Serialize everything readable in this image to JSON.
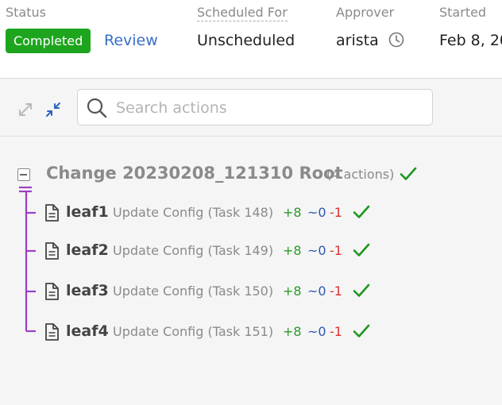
{
  "header": {
    "status": {
      "label": "Status",
      "badge": "Completed",
      "link": "Review"
    },
    "scheduled": {
      "label": "Scheduled For",
      "value": "Unscheduled"
    },
    "approver": {
      "label": "Approver",
      "value": "arista"
    },
    "started": {
      "label": "Started",
      "value": "Feb 8, 20"
    }
  },
  "toolbar": {
    "expand_icon": "expand-icon",
    "collapse_icon": "collapse-icon",
    "search_placeholder": "Search actions"
  },
  "tree": {
    "root": {
      "title": "Change 20230208_121310 Root",
      "count": "(4 actions)"
    },
    "leaves": [
      {
        "name": "leaf1",
        "desc": "Update Config (Task 148)",
        "added": "+8",
        "modified": "~0",
        "removed": "-1"
      },
      {
        "name": "leaf2",
        "desc": "Update Config (Task 149)",
        "added": "+8",
        "modified": "~0",
        "removed": "-1"
      },
      {
        "name": "leaf3",
        "desc": "Update Config (Task 150)",
        "added": "+8",
        "modified": "~0",
        "removed": "-1"
      },
      {
        "name": "leaf4",
        "desc": "Update Config (Task 151)",
        "added": "+8",
        "modified": "~0",
        "removed": "-1"
      }
    ]
  },
  "colors": {
    "success": "#1ea51e",
    "link": "#3a6fc4",
    "tree_line": "#9b3fc4",
    "added": "#2a9a2a",
    "modified": "#2f57b0",
    "removed": "#e03030"
  }
}
